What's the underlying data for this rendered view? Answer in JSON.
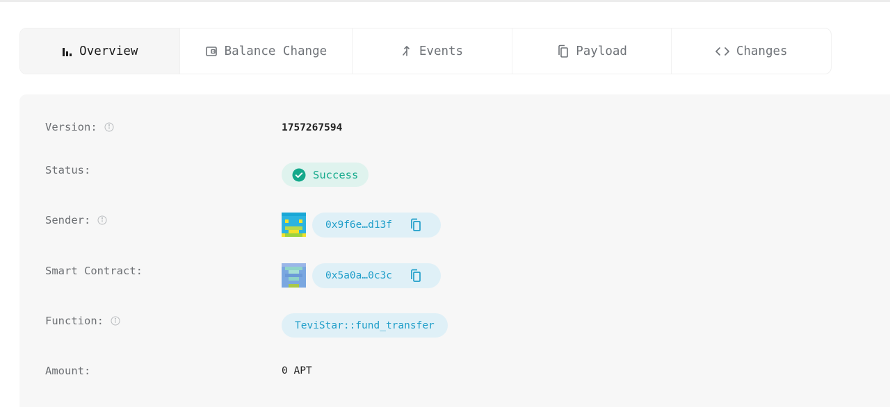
{
  "tabs": [
    {
      "label": "Overview",
      "icon": "bar-chart-icon"
    },
    {
      "label": "Balance Change",
      "icon": "wallet-icon"
    },
    {
      "label": "Events",
      "icon": "merge-icon"
    },
    {
      "label": "Payload",
      "icon": "copy-icon"
    },
    {
      "label": "Changes",
      "icon": "code-icon"
    }
  ],
  "fields": {
    "version": {
      "label": "Version:",
      "value": "1757267594"
    },
    "status": {
      "label": "Status:",
      "value": "Success"
    },
    "sender": {
      "label": "Sender:",
      "address": "0x9f6e…d13f"
    },
    "contract": {
      "label": "Smart Contract:",
      "address": "0x5a0a…0c3c"
    },
    "function": {
      "label": "Function:",
      "value": "TeviStar::fund_transfer"
    },
    "amount": {
      "label": "Amount:",
      "value": "0 APT"
    }
  },
  "colors": {
    "success": "#14a98b",
    "accent": "#1f9ec9"
  }
}
